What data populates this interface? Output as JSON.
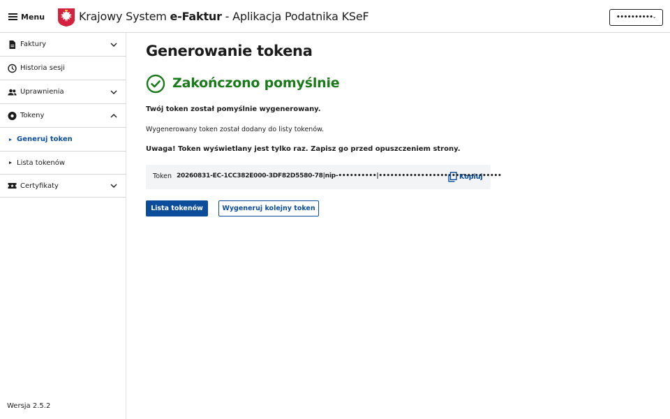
{
  "header": {
    "menu_label": "Menu",
    "title_prefix": "Krajowy System ",
    "title_brand": "e-Faktur",
    "title_suffix": " - Aplikacja Podatnika KSeF",
    "user_masked": "••••••••••"
  },
  "sidebar": {
    "items": [
      {
        "label": "Faktury",
        "icon": "document-icon",
        "expandable": true,
        "expanded": false
      },
      {
        "label": "Historia sesji",
        "icon": "clock-icon",
        "expandable": false
      },
      {
        "label": "Uprawnienia",
        "icon": "users-icon",
        "expandable": true,
        "expanded": false
      },
      {
        "label": "Tokeny",
        "icon": "token-icon",
        "expandable": true,
        "expanded": true
      },
      {
        "label": "Certyfikaty",
        "icon": "certificate-icon",
        "expandable": true,
        "expanded": false
      }
    ],
    "subitems": [
      {
        "label": "Generuj token",
        "active": true
      },
      {
        "label": "Lista tokenów",
        "active": false
      }
    ],
    "version": "Wersja 2.5.2"
  },
  "main": {
    "title": "Generowanie tokena",
    "success_message": "Zakończono pomyślnie",
    "paragraph_generated": "Twój token został pomyślnie wygenerowany.",
    "paragraph_added": "Wygenerowany token został dodany do listy tokenów.",
    "paragraph_warning": "Uwaga! Token wyświetlany jest tylko raz. Zapisz go przed opuszczeniem strony.",
    "token_label": "Token",
    "token_value": "20260831-EC-1CC382E000-3DF82D5580-78|nip-••••••••••|••••••••••••••••••••••••••••••••",
    "copy_label": "Kopiuj",
    "btn_list": "Lista tokenów",
    "btn_generate_another": "Wygeneruj kolejny token"
  },
  "colors": {
    "primary": "#0b4d9b",
    "success": "#1a7a1a",
    "token_bg": "#f3f4f6"
  }
}
